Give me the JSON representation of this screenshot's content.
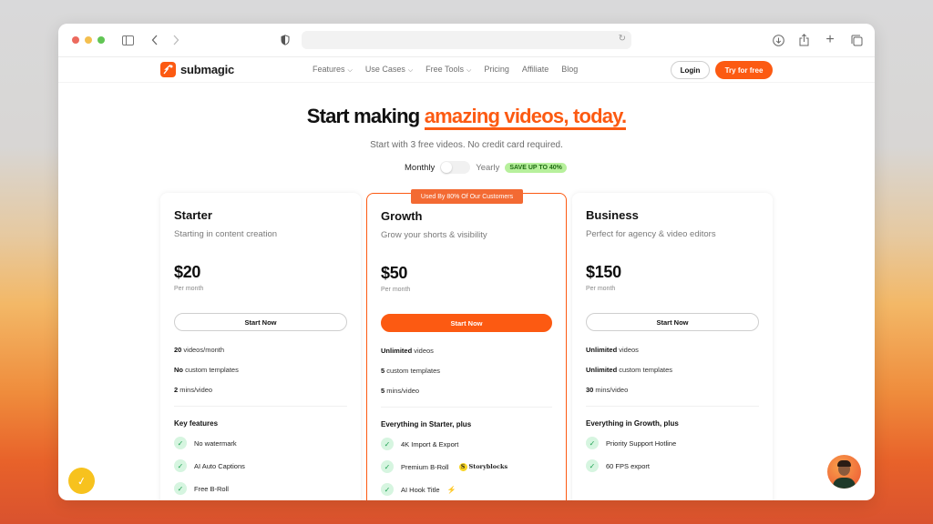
{
  "browser": {
    "address": "",
    "icons": [
      "sidebar-icon",
      "back-icon",
      "forward-icon",
      "privacy-shield-icon",
      "reload-icon",
      "download-icon",
      "share-icon",
      "new-tab-icon",
      "tab-overview-icon"
    ]
  },
  "site": {
    "brand": "submagic",
    "nav": [
      {
        "label": "Features",
        "dropdown": true
      },
      {
        "label": "Use Cases",
        "dropdown": true
      },
      {
        "label": "Free Tools",
        "dropdown": true
      },
      {
        "label": "Pricing",
        "dropdown": false
      },
      {
        "label": "Affiliate",
        "dropdown": false
      },
      {
        "label": "Blog",
        "dropdown": false
      }
    ],
    "login_label": "Login",
    "try_label": "Try for free",
    "accent_color": "#fc5a12"
  },
  "hero": {
    "title_plain": "Start making ",
    "title_accent": "amazing videos, today.",
    "subtitle": "Start with 3 free videos. No credit card required.",
    "billing": {
      "monthly_label": "Monthly",
      "yearly_label": "Yearly",
      "selected": "Monthly",
      "save_badge": "SAVE UP TO 40%"
    }
  },
  "plans": [
    {
      "name": "Starter",
      "description": "Starting in content creation",
      "price": "$20",
      "period": "Per month",
      "cta": "Start Now",
      "featured": false,
      "limits": [
        {
          "bold": "20",
          "rest": " videos/month"
        },
        {
          "bold": "No",
          "rest": " custom templates"
        },
        {
          "bold": "2",
          "rest": " mins/video"
        }
      ],
      "features_heading": "Key features",
      "features": [
        "No watermark",
        "AI Auto Captions",
        "Free B-Roll"
      ]
    },
    {
      "name": "Growth",
      "description": "Grow your shorts & visibility",
      "price": "$50",
      "period": "Per month",
      "cta": "Start Now",
      "featured": true,
      "badge": "Used By 80% Of Our Customers",
      "limits": [
        {
          "bold": "Unlimited",
          "rest": " videos"
        },
        {
          "bold": "5",
          "rest": " custom templates"
        },
        {
          "bold": "5",
          "rest": " mins/video"
        }
      ],
      "features_heading": "Everything in Starter, plus",
      "features": [
        "4K Import & Export",
        "Premium B-Roll",
        "AI Hook Title"
      ],
      "partner_logo": "Storyblocks"
    },
    {
      "name": "Business",
      "description": "Perfect for agency & video editors",
      "price": "$150",
      "period": "Per month",
      "cta": "Start Now",
      "featured": false,
      "limits": [
        {
          "bold": "Unlimited",
          "rest": " videos"
        },
        {
          "bold": "Unlimited",
          "rest": " custom templates"
        },
        {
          "bold": "30",
          "rest": " mins/video"
        }
      ],
      "features_heading": "Everything in Growth, plus",
      "features": [
        "Priority Support Hotline",
        "60 FPS export"
      ]
    }
  ]
}
